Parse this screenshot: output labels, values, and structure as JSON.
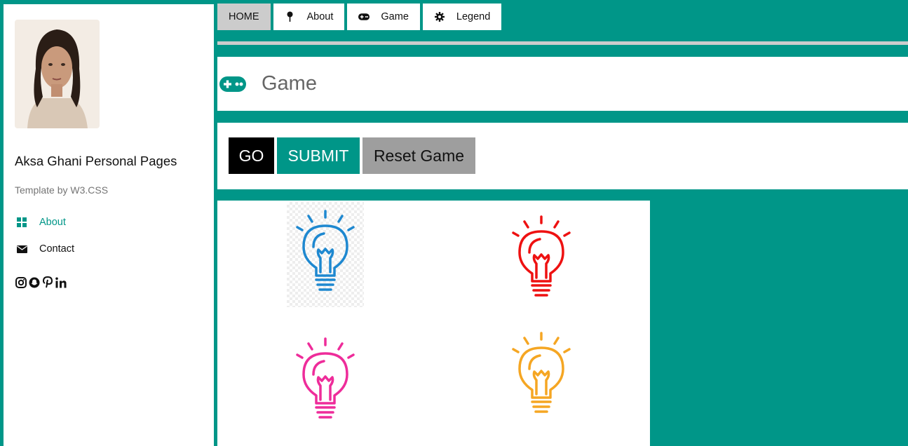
{
  "sidebar": {
    "title": "Aksa Ghani Personal Pages",
    "subtitle": "Template by W3.CSS",
    "links": [
      {
        "label": "About",
        "icon": "grid-icon"
      },
      {
        "label": "Contact",
        "icon": "envelope-icon"
      }
    ],
    "social_icons": [
      "instagram-icon",
      "snapchat-icon",
      "pinterest-icon",
      "linkedin-icon"
    ]
  },
  "nav": {
    "items": [
      {
        "label": "HOME"
      },
      {
        "label": "About",
        "icon": "map-pin-icon"
      },
      {
        "label": "Game",
        "icon": "gamepad-icon"
      },
      {
        "label": "Legend",
        "icon": "gear-icon"
      }
    ]
  },
  "header": {
    "title": "Game",
    "icon": "gamepad-icon"
  },
  "controls": {
    "go": "GO",
    "submit": "SUBMIT",
    "reset": "Reset Game"
  },
  "bulbs": [
    {
      "color": "#1e88d0",
      "icon": "lightbulb-icon"
    },
    {
      "color": "#ee1111",
      "icon": "lightbulb-icon"
    },
    {
      "color": "#ee2c9a",
      "icon": "lightbulb-icon"
    },
    {
      "color": "#f5a623",
      "icon": "lightbulb-icon"
    }
  ],
  "colors": {
    "accent": "#009688",
    "nav_active": "#cccccc",
    "reset_button": "#9e9e9e"
  }
}
